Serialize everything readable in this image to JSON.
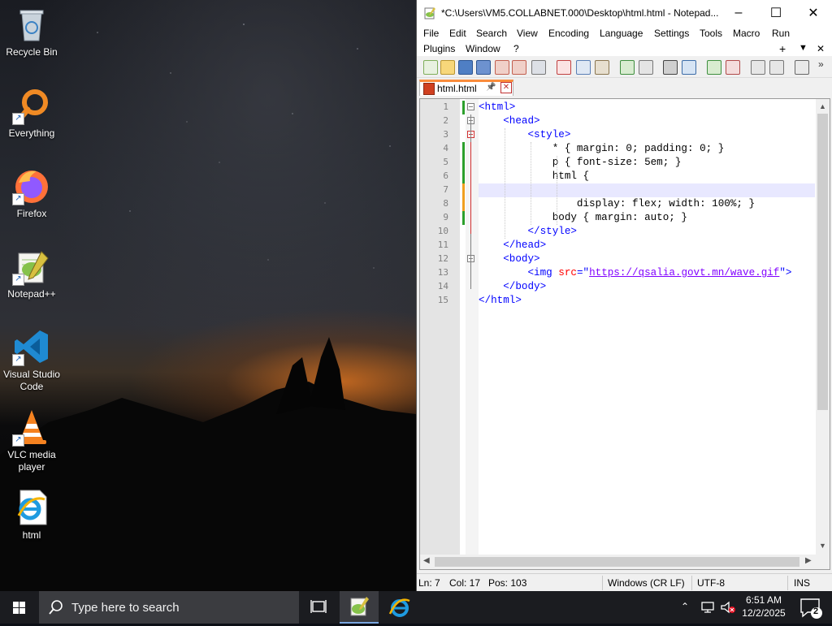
{
  "desktop": {
    "icons": [
      {
        "label": "Recycle Bin",
        "icon": "recycle-bin-icon"
      },
      {
        "label": "Everything",
        "icon": "everything-search-icon"
      },
      {
        "label": "Firefox",
        "icon": "firefox-icon"
      },
      {
        "label": "Notepad++",
        "icon": "notepad-plus-plus-icon"
      },
      {
        "label": "Visual Studio Code",
        "icon": "vscode-icon"
      },
      {
        "label": "VLC media player",
        "icon": "vlc-icon"
      },
      {
        "label": "html",
        "icon": "internet-explorer-file-icon"
      }
    ]
  },
  "window": {
    "title": "*C:\\Users\\VM5.COLLABNET.000\\Desktop\\html.html - Notepad...",
    "minimize": "–",
    "maximize": "☐",
    "close": "✕"
  },
  "menu": {
    "row1": [
      "File",
      "Edit",
      "Search",
      "View",
      "Encoding",
      "Language",
      "Settings",
      "Tools",
      "Macro",
      "Run"
    ],
    "row2": [
      "Plugins",
      "Window",
      "?"
    ],
    "plus": "+",
    "dropdown": "▼",
    "close": "✕"
  },
  "tab": {
    "label": "html.html",
    "pin": "📌",
    "close": "✕"
  },
  "editor": {
    "current_line": 7,
    "lines": [
      {
        "n": "1",
        "indent": "",
        "parts": [
          {
            "t": "<html>",
            "c": "tag"
          }
        ]
      },
      {
        "n": "2",
        "indent": "    ",
        "parts": [
          {
            "t": "<head>",
            "c": "tag"
          }
        ]
      },
      {
        "n": "3",
        "indent": "        ",
        "parts": [
          {
            "t": "<style>",
            "c": "tag"
          }
        ]
      },
      {
        "n": "4",
        "indent": "            ",
        "parts": [
          {
            "t": "* { margin: 0; padding: 0; }",
            "c": ""
          }
        ]
      },
      {
        "n": "5",
        "indent": "            ",
        "parts": [
          {
            "t": "p { font-size: 5em; }",
            "c": ""
          }
        ]
      },
      {
        "n": "6",
        "indent": "            ",
        "parts": [
          {
            "t": "html {",
            "c": ""
          }
        ]
      },
      {
        "n": "7",
        "indent": "",
        "parts": []
      },
      {
        "n": "8",
        "indent": "                ",
        "parts": [
          {
            "t": "display: flex; width: 100%; }",
            "c": ""
          }
        ]
      },
      {
        "n": "9",
        "indent": "            ",
        "parts": [
          {
            "t": "body { margin: auto; }",
            "c": ""
          }
        ]
      },
      {
        "n": "10",
        "indent": "        ",
        "parts": [
          {
            "t": "</style>",
            "c": "tag"
          }
        ]
      },
      {
        "n": "11",
        "indent": "    ",
        "parts": [
          {
            "t": "</head>",
            "c": "tag"
          }
        ]
      },
      {
        "n": "12",
        "indent": "    ",
        "parts": [
          {
            "t": "<body>",
            "c": "tag"
          }
        ]
      },
      {
        "n": "13",
        "indent": "        ",
        "parts": [
          {
            "t": "<img ",
            "c": "tag"
          },
          {
            "t": "src",
            "c": "attr"
          },
          {
            "t": "=\"",
            "c": "tag"
          },
          {
            "t": "https://qsalia.govt.mn/wave.gif",
            "c": "str"
          },
          {
            "t": "\">",
            "c": "tag"
          }
        ]
      },
      {
        "n": "14",
        "indent": "    ",
        "parts": [
          {
            "t": "</body>",
            "c": "tag"
          }
        ]
      },
      {
        "n": "15",
        "indent": "",
        "parts": [
          {
            "t": "</html>",
            "c": "tag"
          }
        ]
      }
    ]
  },
  "status": {
    "line": "Ln: 7",
    "col": "Col: 17",
    "pos": "Pos: 103",
    "eol": "Windows (CR LF)",
    "encoding": "UTF-8",
    "mode": "INS"
  },
  "taskbar": {
    "search_placeholder": "Type here to search",
    "time": "6:51 AM",
    "date": "12/2/2025",
    "notification_count": "2"
  }
}
